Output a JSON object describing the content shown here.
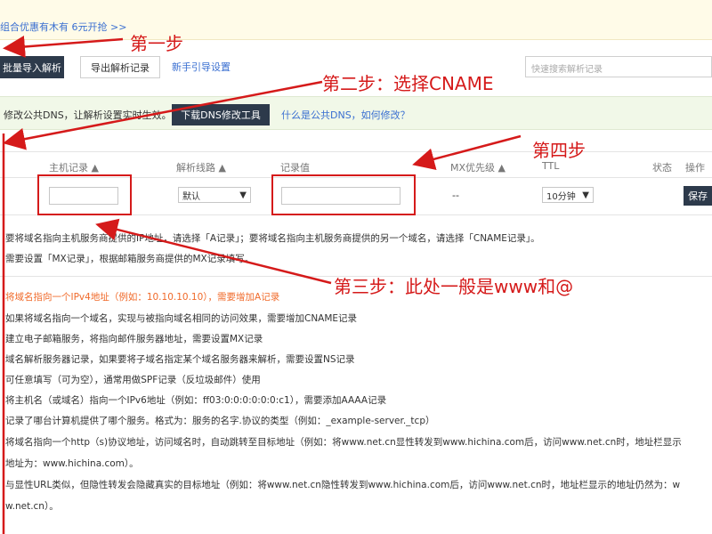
{
  "promo": {
    "text": "组合优惠有木有 6元开抢 >>"
  },
  "toolbar": {
    "batch_import": "批量导入解析",
    "export": "导出解析记录",
    "guide": "新手引导设置",
    "search_placeholder": "快速搜索解析记录"
  },
  "notice": {
    "text": "修改公共DNS，让解析设置实时生效。",
    "download_button": "下载DNS修改工具",
    "link": "什么是公共DNS，如何修改？"
  },
  "table": {
    "headers": {
      "host": "主机记录 ▲",
      "line": "解析线路 ▲",
      "value": "记录值",
      "mx": "MX优先级 ▲",
      "ttl": "TTL",
      "status": "状态",
      "op": "操作"
    },
    "row": {
      "line_selected": "默认",
      "mx": "--",
      "ttl_selected": "10分钟",
      "save": "保存"
    }
  },
  "help": {
    "line1": "要将域名指向主机服务商提供的IP地址，请选择「A记录」；要将域名指向主机服务商提供的另一个域名，请选择「CNAME记录」。",
    "line2": "需要设置「MX记录」，根据邮箱服务商提供的MX记录填写。"
  },
  "tips": {
    "a": "将域名指向一个IPv4地址（例如：10.10.10.10），需要增加A记录",
    "cname": "如果将域名指向一个域名，实现与被指向域名相同的访问效果，需要增加CNAME记录",
    "mx": "建立电子邮箱服务，将指向邮件服务器地址，需要设置MX记录",
    "ns": "域名解析服务器记录，如果要将子域名指定某个域名服务器来解析，需要设置NS记录",
    "txt": "可任意填写（可为空），通常用做SPF记录（反垃圾邮件）使用",
    "aaaa": "将主机名（或域名）指向一个IPv6地址（例如：ff03:0:0:0:0:0:0:c1），需要添加AAAA记录",
    "srv": "记录了哪台计算机提供了哪个服务。格式为：服务的名字.协议的类型（例如：_example-server._tcp）",
    "url1": "将域名指向一个http（s)协议地址，访问域名时，自动跳转至目标地址（例如：将www.net.cn显性转发到www.hichina.com后，访问www.net.cn时，地址栏显示",
    "url2": "地址为：www.hichina.com）。",
    "hidden1": "与显性URL类似，但隐性转发会隐藏真实的目标地址（例如：将www.net.cn隐性转发到www.hichina.com后，访问www.net.cn时，地址栏显示的地址仍然为：w",
    "hidden2": "w.net.cn）。"
  },
  "annotations": {
    "step1": "第一步",
    "step2": "第二步：选择CNAME",
    "step3": "第三步：此处一般是www和@",
    "step4": "第四步",
    "color": "#d51a1a"
  }
}
